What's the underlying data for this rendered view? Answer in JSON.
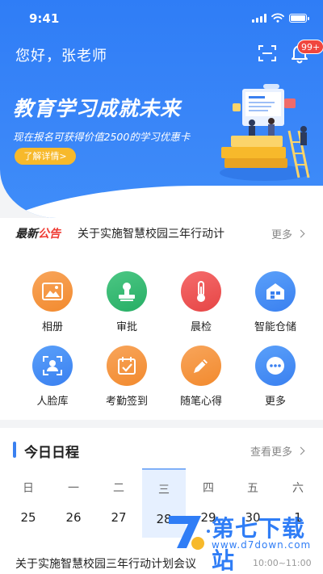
{
  "status_bar": {
    "time": "9:41"
  },
  "header": {
    "greeting": "您好，张老师",
    "badge": "99+",
    "icons": {
      "scan": "scan-icon",
      "bell": "bell-icon"
    }
  },
  "banner": {
    "title": "教育学习成就未来",
    "subtitle": "现在报名可获得价值2500的学习优惠卡",
    "button": "了解详情>",
    "slide_count": 4,
    "active_slide": 1
  },
  "notice": {
    "tag_part1": "最新",
    "tag_part2": "公告",
    "text": "关于实施智慧校园三年行动计",
    "more": "更多"
  },
  "grid": {
    "items": [
      {
        "label": "相册",
        "icon": "photo-album-icon",
        "color": "#f28a2e"
      },
      {
        "label": "审批",
        "icon": "approval-stamp-icon",
        "color": "#27ae65"
      },
      {
        "label": "晨检",
        "icon": "thermometer-icon",
        "color": "#e64545"
      },
      {
        "label": "智能仓储",
        "icon": "warehouse-icon",
        "color": "#3a80f0"
      },
      {
        "label": "人脸库",
        "icon": "face-scan-icon",
        "color": "#3a80f0"
      },
      {
        "label": "考勤签到",
        "icon": "calendar-check-icon",
        "color": "#f28a2e"
      },
      {
        "label": "随笔心得",
        "icon": "pencil-icon",
        "color": "#f28a2e"
      },
      {
        "label": "更多",
        "icon": "more-dots-icon",
        "color": "#3a80f0"
      }
    ]
  },
  "schedule": {
    "title": "今日日程",
    "more": "查看更多",
    "days": [
      {
        "weekday": "日",
        "date": "25"
      },
      {
        "weekday": "一",
        "date": "26"
      },
      {
        "weekday": "二",
        "date": "27"
      },
      {
        "weekday": "三",
        "date": "28"
      },
      {
        "weekday": "四",
        "date": "29"
      },
      {
        "weekday": "五",
        "date": "30"
      },
      {
        "weekday": "六",
        "date": "1"
      }
    ],
    "active_index": 3,
    "item_title": "关于实施智慧校园三年行动计划会议",
    "item_time": "10:00~11:00"
  },
  "watermark": {
    "text": "第七下载站",
    "url": "www.d7down.com"
  },
  "colors": {
    "primary": "#2f7df6",
    "accent": "#f7b92b",
    "alert": "#ef3b33"
  }
}
